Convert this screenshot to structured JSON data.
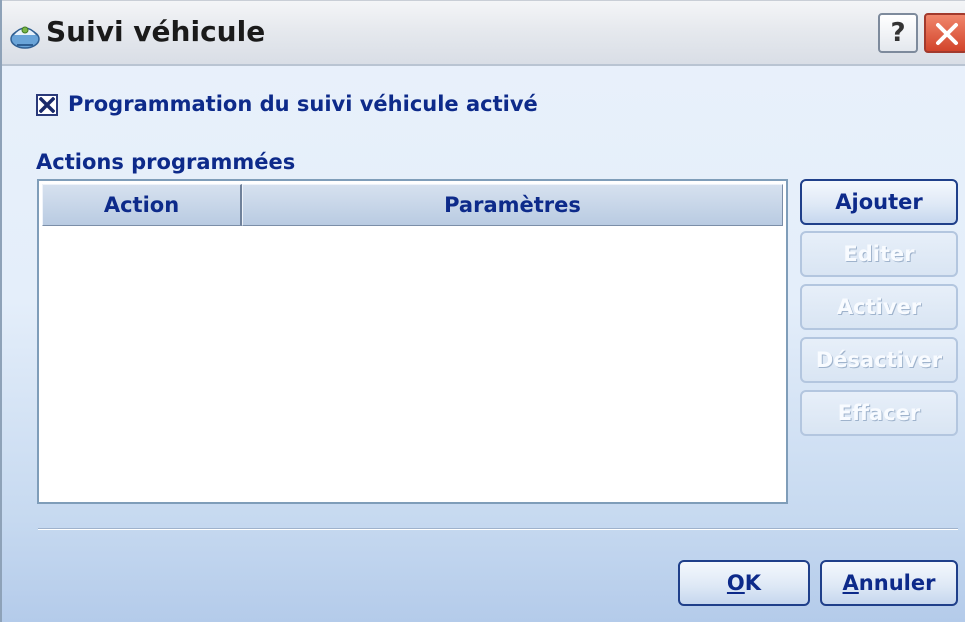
{
  "window": {
    "title": "Suivi véhicule",
    "help_glyph": "?",
    "icons": {
      "app": "satellite-dish-icon",
      "help": "question-mark-icon",
      "close": "close-x-icon"
    }
  },
  "schedule": {
    "checkbox_label": "Programmation du suivi véhicule activé",
    "checkbox_checked": true,
    "section_label": "Actions programmées"
  },
  "table": {
    "columns": [
      "Action",
      "Paramètres"
    ],
    "rows": []
  },
  "side_buttons": {
    "add": "Ajouter",
    "edit": "Editer",
    "activate": "Activer",
    "deactivate": "Désactiver",
    "delete": "Effacer"
  },
  "footer": {
    "ok_mnemonic": "O",
    "ok_rest": "K",
    "cancel_mnemonic": "A",
    "cancel_rest": "nnuler"
  },
  "colors": {
    "accent_text": "#0d2a8a",
    "close_button": "#d2442b",
    "disabled_text": "#f8fbff"
  }
}
